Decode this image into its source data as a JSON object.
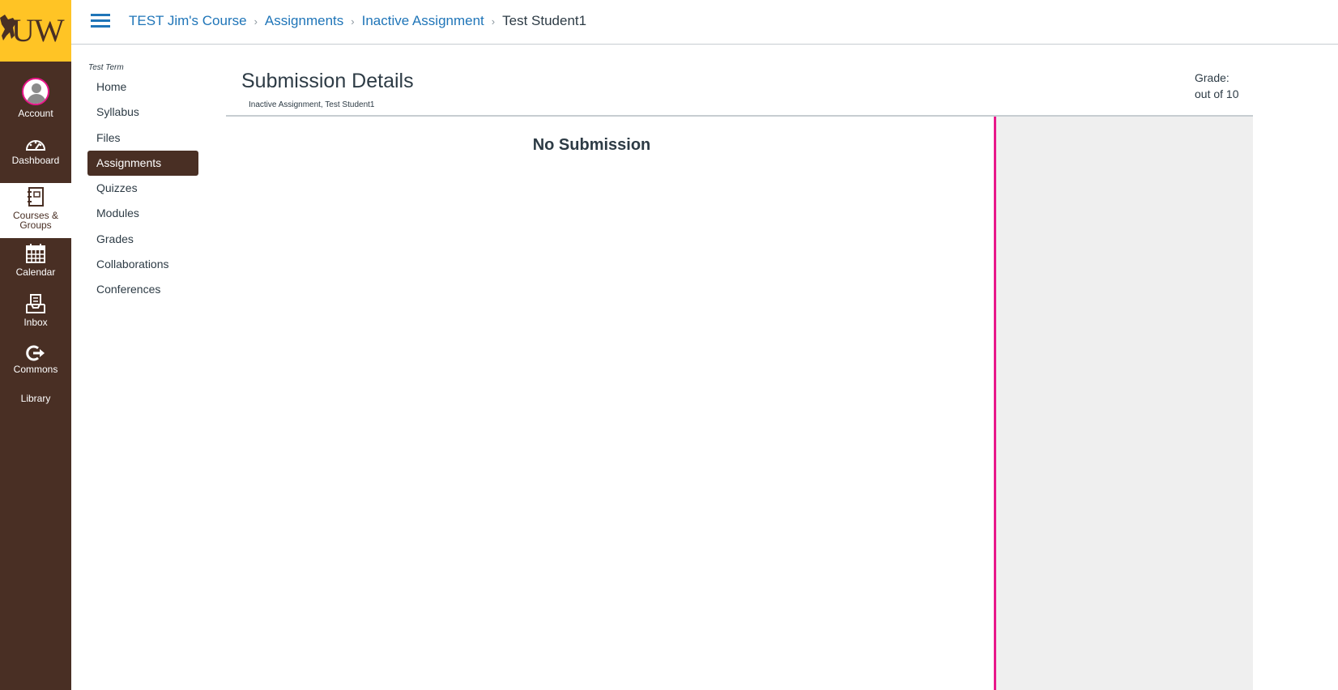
{
  "global_nav": {
    "logo_text": "UW",
    "items": [
      {
        "label": "Account",
        "icon": "avatar"
      },
      {
        "label": "Dashboard",
        "icon": "dashboard-icon"
      },
      {
        "label": "Courses & Groups",
        "icon": "courses-icon"
      },
      {
        "label": "Calendar",
        "icon": "calendar-icon"
      },
      {
        "label": "Inbox",
        "icon": "inbox-icon"
      },
      {
        "label": "Commons",
        "icon": "commons-icon"
      },
      {
        "label": "Library",
        "icon": ""
      }
    ],
    "colors": {
      "brand": "#492f24",
      "logo_bg": "#ffc425",
      "accent": "#e8178a",
      "link": "#1f75b8"
    }
  },
  "header": {
    "breadcrumb": [
      "TEST Jim's Course",
      "Assignments",
      "Inactive Assignment"
    ],
    "breadcrumb_current": "Test Student1"
  },
  "course_nav": {
    "term": "Test Term",
    "items": [
      "Home",
      "Syllabus",
      "Files",
      "Assignments",
      "Quizzes",
      "Modules",
      "Grades",
      "Collaborations",
      "Conferences"
    ],
    "active": "Assignments"
  },
  "main": {
    "title": "Submission Details",
    "subtitle": "Inactive Assignment, Test Student1",
    "grade_label": "Grade:",
    "grade_out_of": "out of 10",
    "no_submission": "No Submission"
  }
}
